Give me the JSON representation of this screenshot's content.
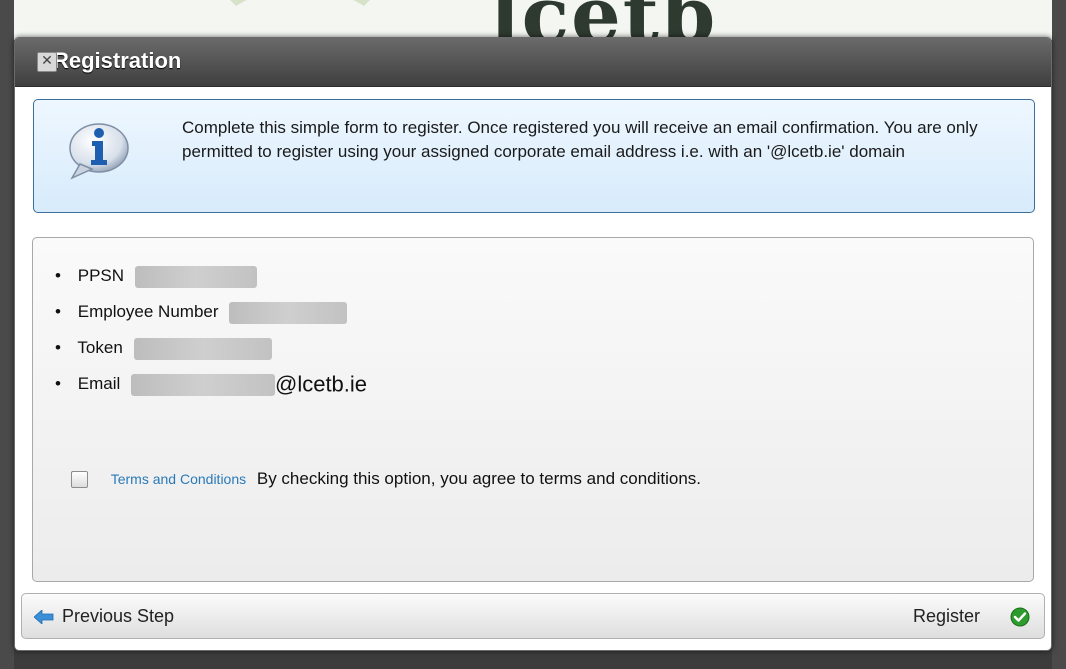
{
  "background": {
    "logo_text": "lcetb"
  },
  "dialog": {
    "title": "Registration",
    "close_glyph": "✕"
  },
  "info": {
    "icon": "info-icon",
    "message": "Complete this simple form to register. Once registered you will receive an email confirmation. You are only permitted to register using your assigned corporate email address i.e. with an '@lcetb.ie' domain"
  },
  "fields": [
    {
      "label": "PPSN",
      "value": "[redacted]"
    },
    {
      "label": "Employee Number",
      "value": "[redacted]"
    },
    {
      "label": "Token",
      "value": "[redacted]"
    },
    {
      "label": "Email",
      "value": "[redacted]",
      "suffix": "@lcetb.ie"
    }
  ],
  "terms": {
    "link_text": "Terms and Conditions",
    "agreement_text": "By checking this option, you agree to terms and conditions.",
    "checked": false
  },
  "footer": {
    "previous_label": "Previous Step",
    "register_label": "Register"
  },
  "colors": {
    "title_bar": "#4f4f4f",
    "info_border": "#3c6f9c",
    "link": "#2a7ab8",
    "register_check": "#2e9b2e",
    "prev_arrow": "#3b8fd6"
  }
}
